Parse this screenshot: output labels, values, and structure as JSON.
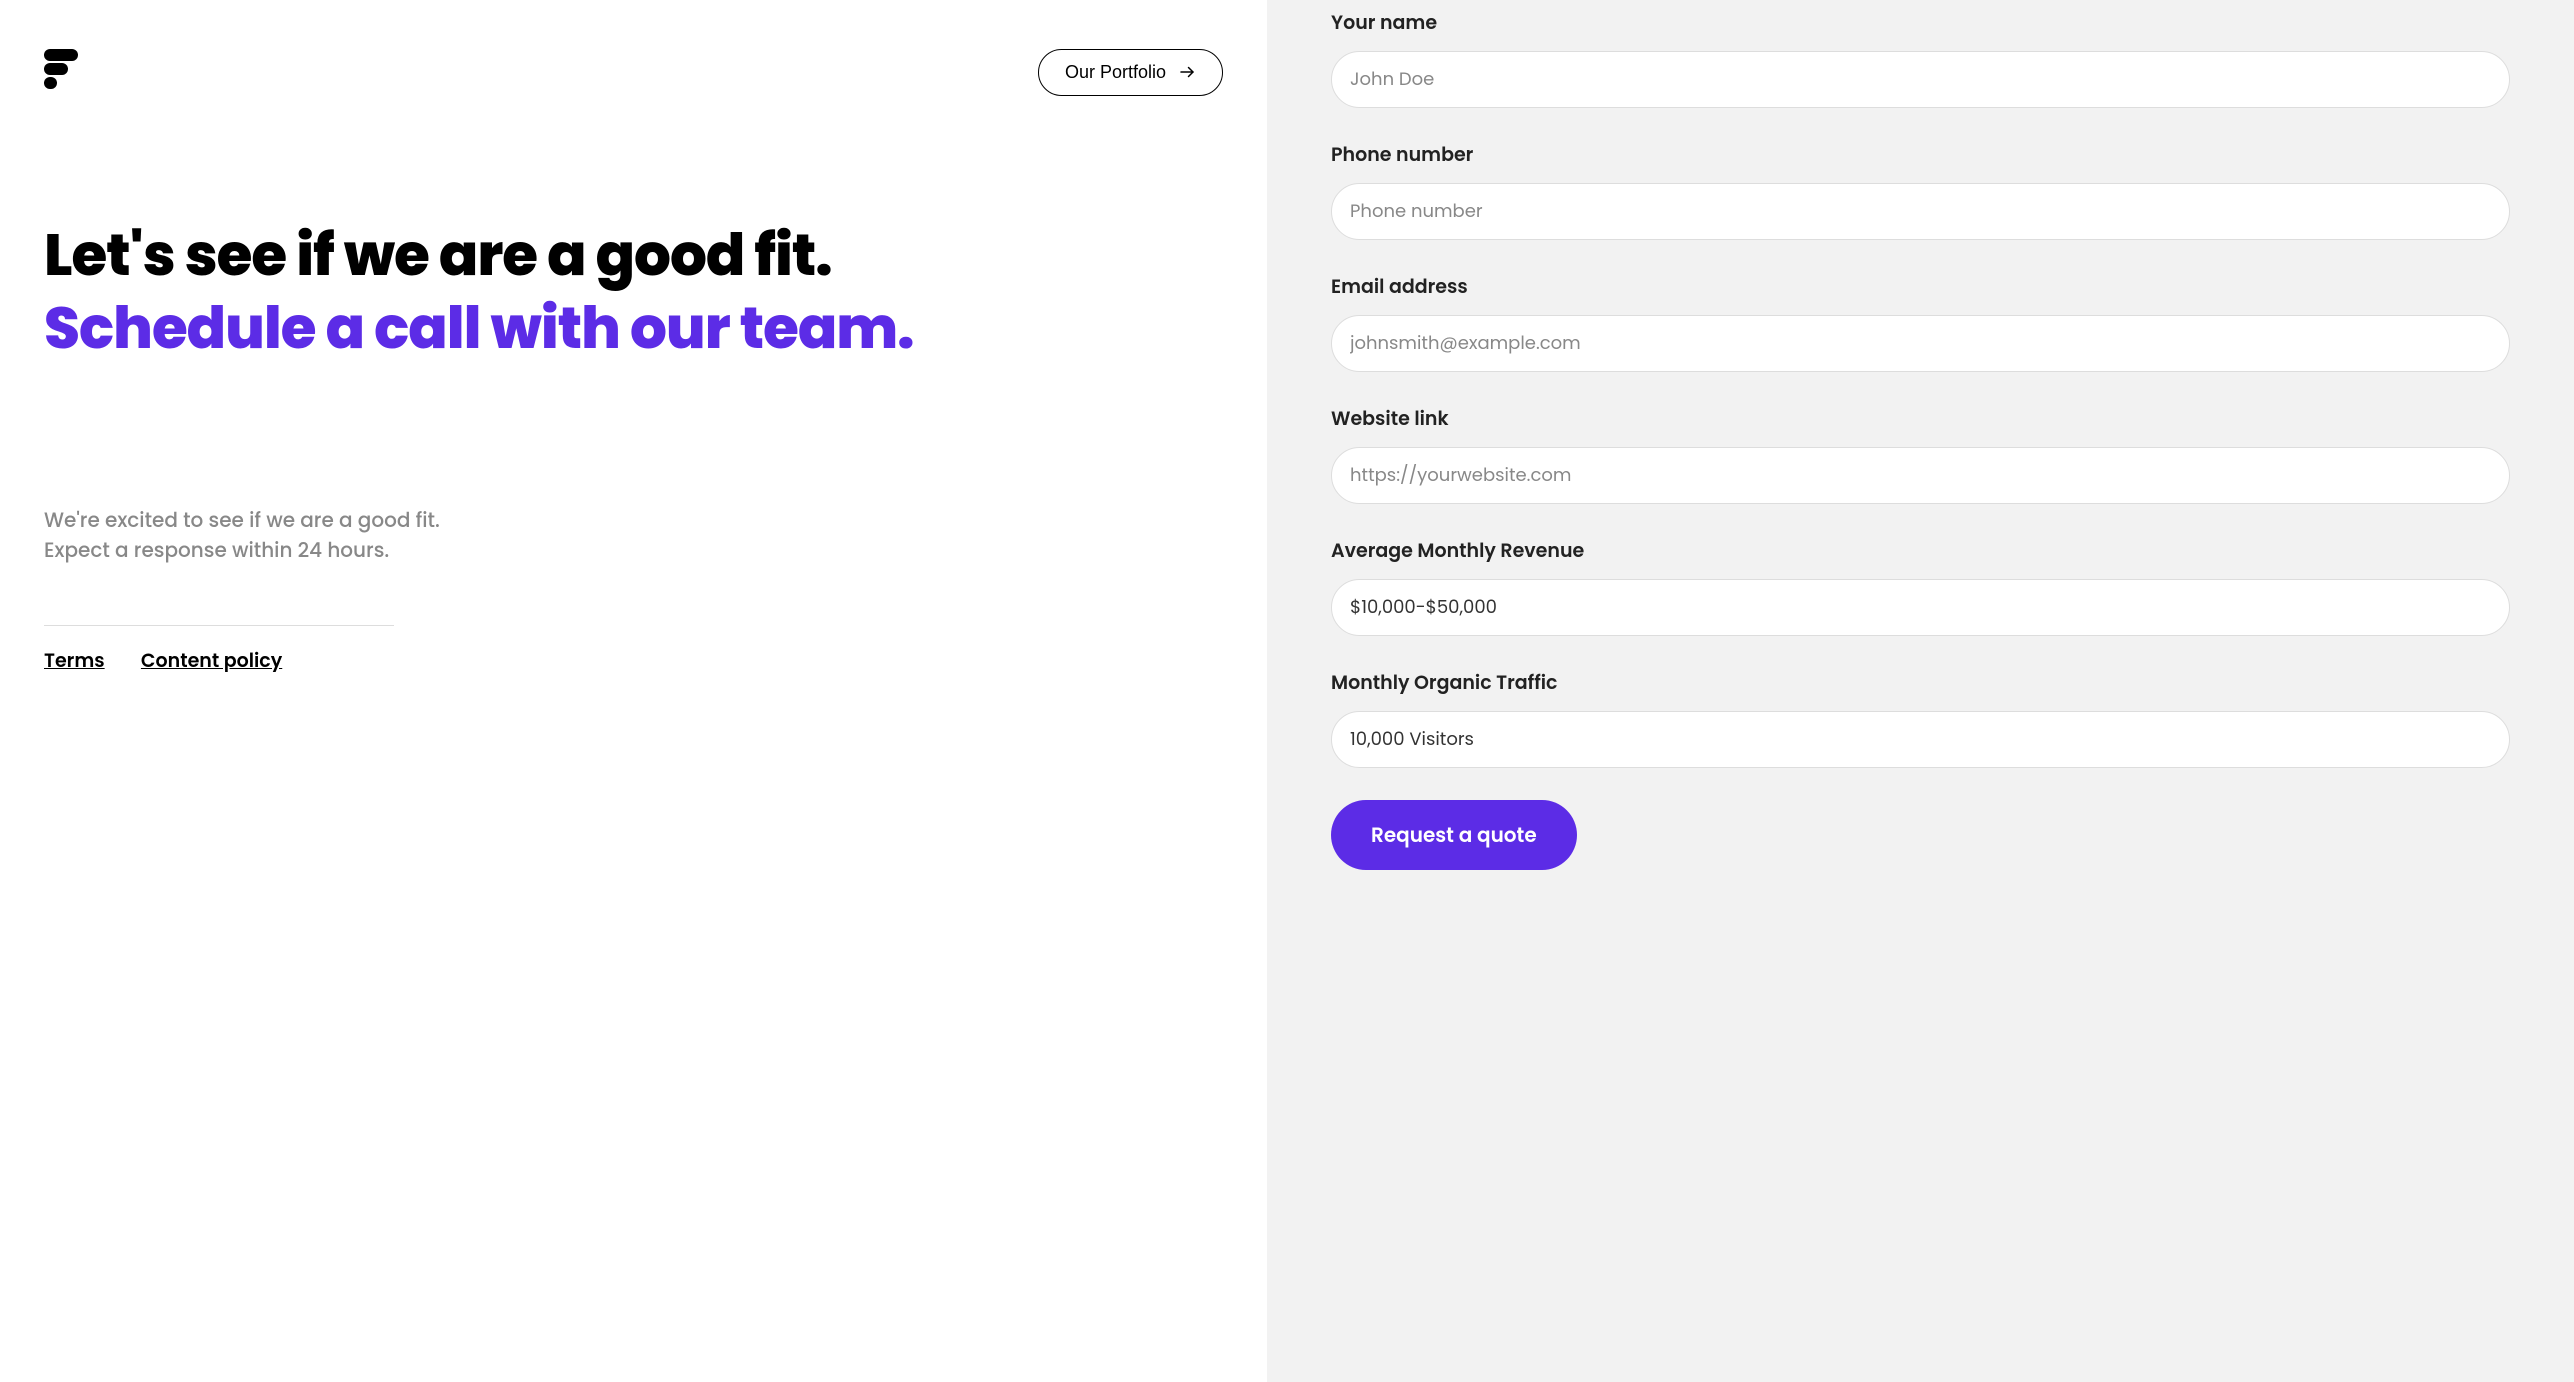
{
  "header": {
    "portfolio_label": "Our Portfolio"
  },
  "hero": {
    "line1": "Let's see if we are a good fit.",
    "line2": "Schedule a call with our team."
  },
  "subtext": "We're excited to see if we are a good fit. Expect a response within 24 hours.",
  "footer": {
    "terms": "Terms",
    "content_policy": "Content policy"
  },
  "form": {
    "name_label": "Your name",
    "name_placeholder": "John Doe",
    "phone_label": "Phone number",
    "phone_placeholder": "Phone number",
    "email_label": "Email address",
    "email_placeholder": "johnsmith@example.com",
    "website_label": "Website link",
    "website_placeholder": "https://yourwebsite.com",
    "revenue_label": "Average Monthly Revenue",
    "revenue_value": "$10,000-$50,000",
    "traffic_label": "Monthly Organic Traffic",
    "traffic_value": "10,000 Visitors",
    "submit_label": "Request a quote"
  },
  "colors": {
    "accent": "#5c2ce6"
  }
}
